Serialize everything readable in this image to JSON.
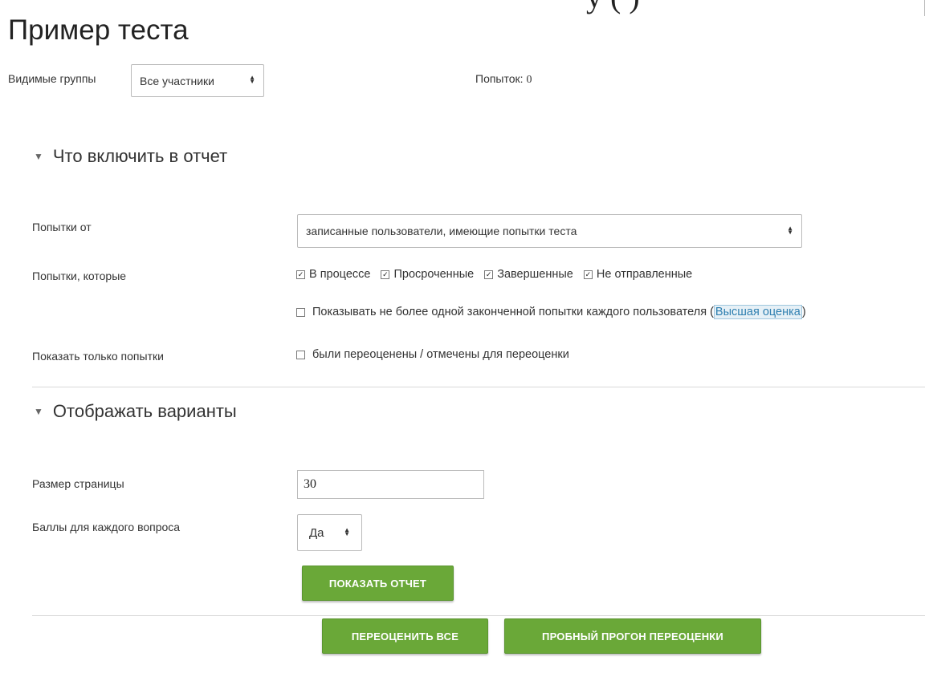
{
  "header": {
    "clipped_text": "у  (  )",
    "title": "Пример теста"
  },
  "groups": {
    "label": "Видимые группы",
    "selected": "Все участники"
  },
  "attempts": {
    "label": "Попыток:",
    "value": "0"
  },
  "section_include": {
    "heading": "Что включить в отчет",
    "attempts_from_label": "Попытки от",
    "attempts_from_selected": "записанные пользователи, имеющие попытки теста",
    "attempts_that_label": "Попытки, которые",
    "states": [
      {
        "label": "В процессе",
        "checked": true
      },
      {
        "label": "Просроченные",
        "checked": true
      },
      {
        "label": "Завершенные",
        "checked": true
      },
      {
        "label": "Не отправленные",
        "checked": true
      }
    ],
    "only_one_label": "Показывать не более одной законченной попытки каждого пользователя (",
    "only_one_link": "Высшая оценка",
    "only_one_close": ")",
    "only_one_checked": false,
    "show_only_label": "Показать только попытки",
    "regraded_label": "были переоценены / отмечены для переоценки",
    "regraded_checked": false
  },
  "section_display": {
    "heading": "Отображать варианты",
    "page_size_label": "Размер страницы",
    "page_size_value": "30",
    "marks_label": "Баллы для каждого вопроса",
    "marks_selected": "Да"
  },
  "buttons": {
    "show_report": "ПОКАЗАТЬ ОТЧЕТ",
    "regrade_all": "ПЕРЕОЦЕНИТЬ ВСЕ",
    "dry_run": "ПРОБНЫЙ ПРОГОН ПЕРЕОЦЕНКИ"
  },
  "colors": {
    "button_green": "#6aa838",
    "link_blue": "#2f7fb0"
  }
}
